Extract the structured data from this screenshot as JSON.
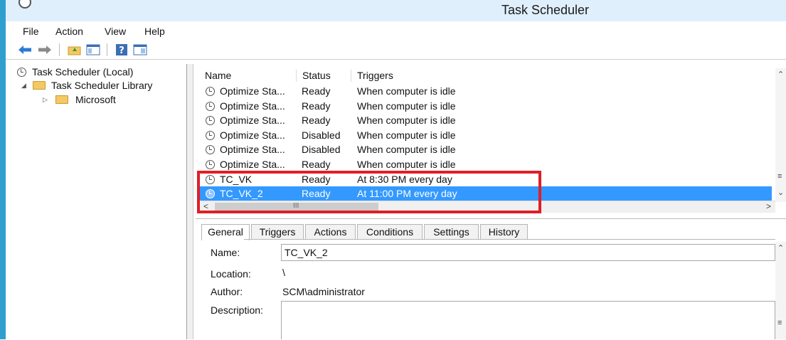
{
  "window": {
    "title": "Task Scheduler"
  },
  "menu": [
    "File",
    "Action",
    "View",
    "Help"
  ],
  "toolbar": {
    "icons": [
      "back-arrow-icon",
      "forward-arrow-icon",
      "up-folder-icon",
      "show-hide-console-tree-icon",
      "help-icon",
      "show-hide-action-pane-icon"
    ]
  },
  "tree": {
    "root": "Task Scheduler (Local)",
    "library": "Task Scheduler Library",
    "child": "Microsoft"
  },
  "task_list": {
    "headers": [
      "Name",
      "Status",
      "Triggers"
    ],
    "rows": [
      {
        "name": "Optimize Sta...",
        "status": "Ready",
        "trigger": "When computer is idle"
      },
      {
        "name": "Optimize Sta...",
        "status": "Ready",
        "trigger": "When computer is idle"
      },
      {
        "name": "Optimize Sta...",
        "status": "Ready",
        "trigger": "When computer is idle"
      },
      {
        "name": "Optimize Sta...",
        "status": "Disabled",
        "trigger": "When computer is idle"
      },
      {
        "name": "Optimize Sta...",
        "status": "Disabled",
        "trigger": "When computer is idle"
      },
      {
        "name": "Optimize Sta...",
        "status": "Ready",
        "trigger": "When computer is idle"
      },
      {
        "name": "TC_VK",
        "status": "Ready",
        "trigger": "At 8:30 PM every day"
      },
      {
        "name": "TC_VK_2",
        "status": "Ready",
        "trigger": "At 11:00 PM every day"
      }
    ],
    "selected_index": 7,
    "hscroll_grip": "III"
  },
  "details": {
    "tabs": [
      "General",
      "Triggers",
      "Actions",
      "Conditions",
      "Settings",
      "History"
    ],
    "active_tab": "General",
    "labels": {
      "name": "Name:",
      "location": "Location:",
      "author": "Author:",
      "description": "Description:"
    },
    "values": {
      "name": "TC_VK_2",
      "location": "\\",
      "author": "SCM\\administrator",
      "description": ""
    }
  },
  "colors": {
    "selection": "#3399ff",
    "highlight_box": "#e01e26",
    "frame": "#2f9fd0"
  }
}
